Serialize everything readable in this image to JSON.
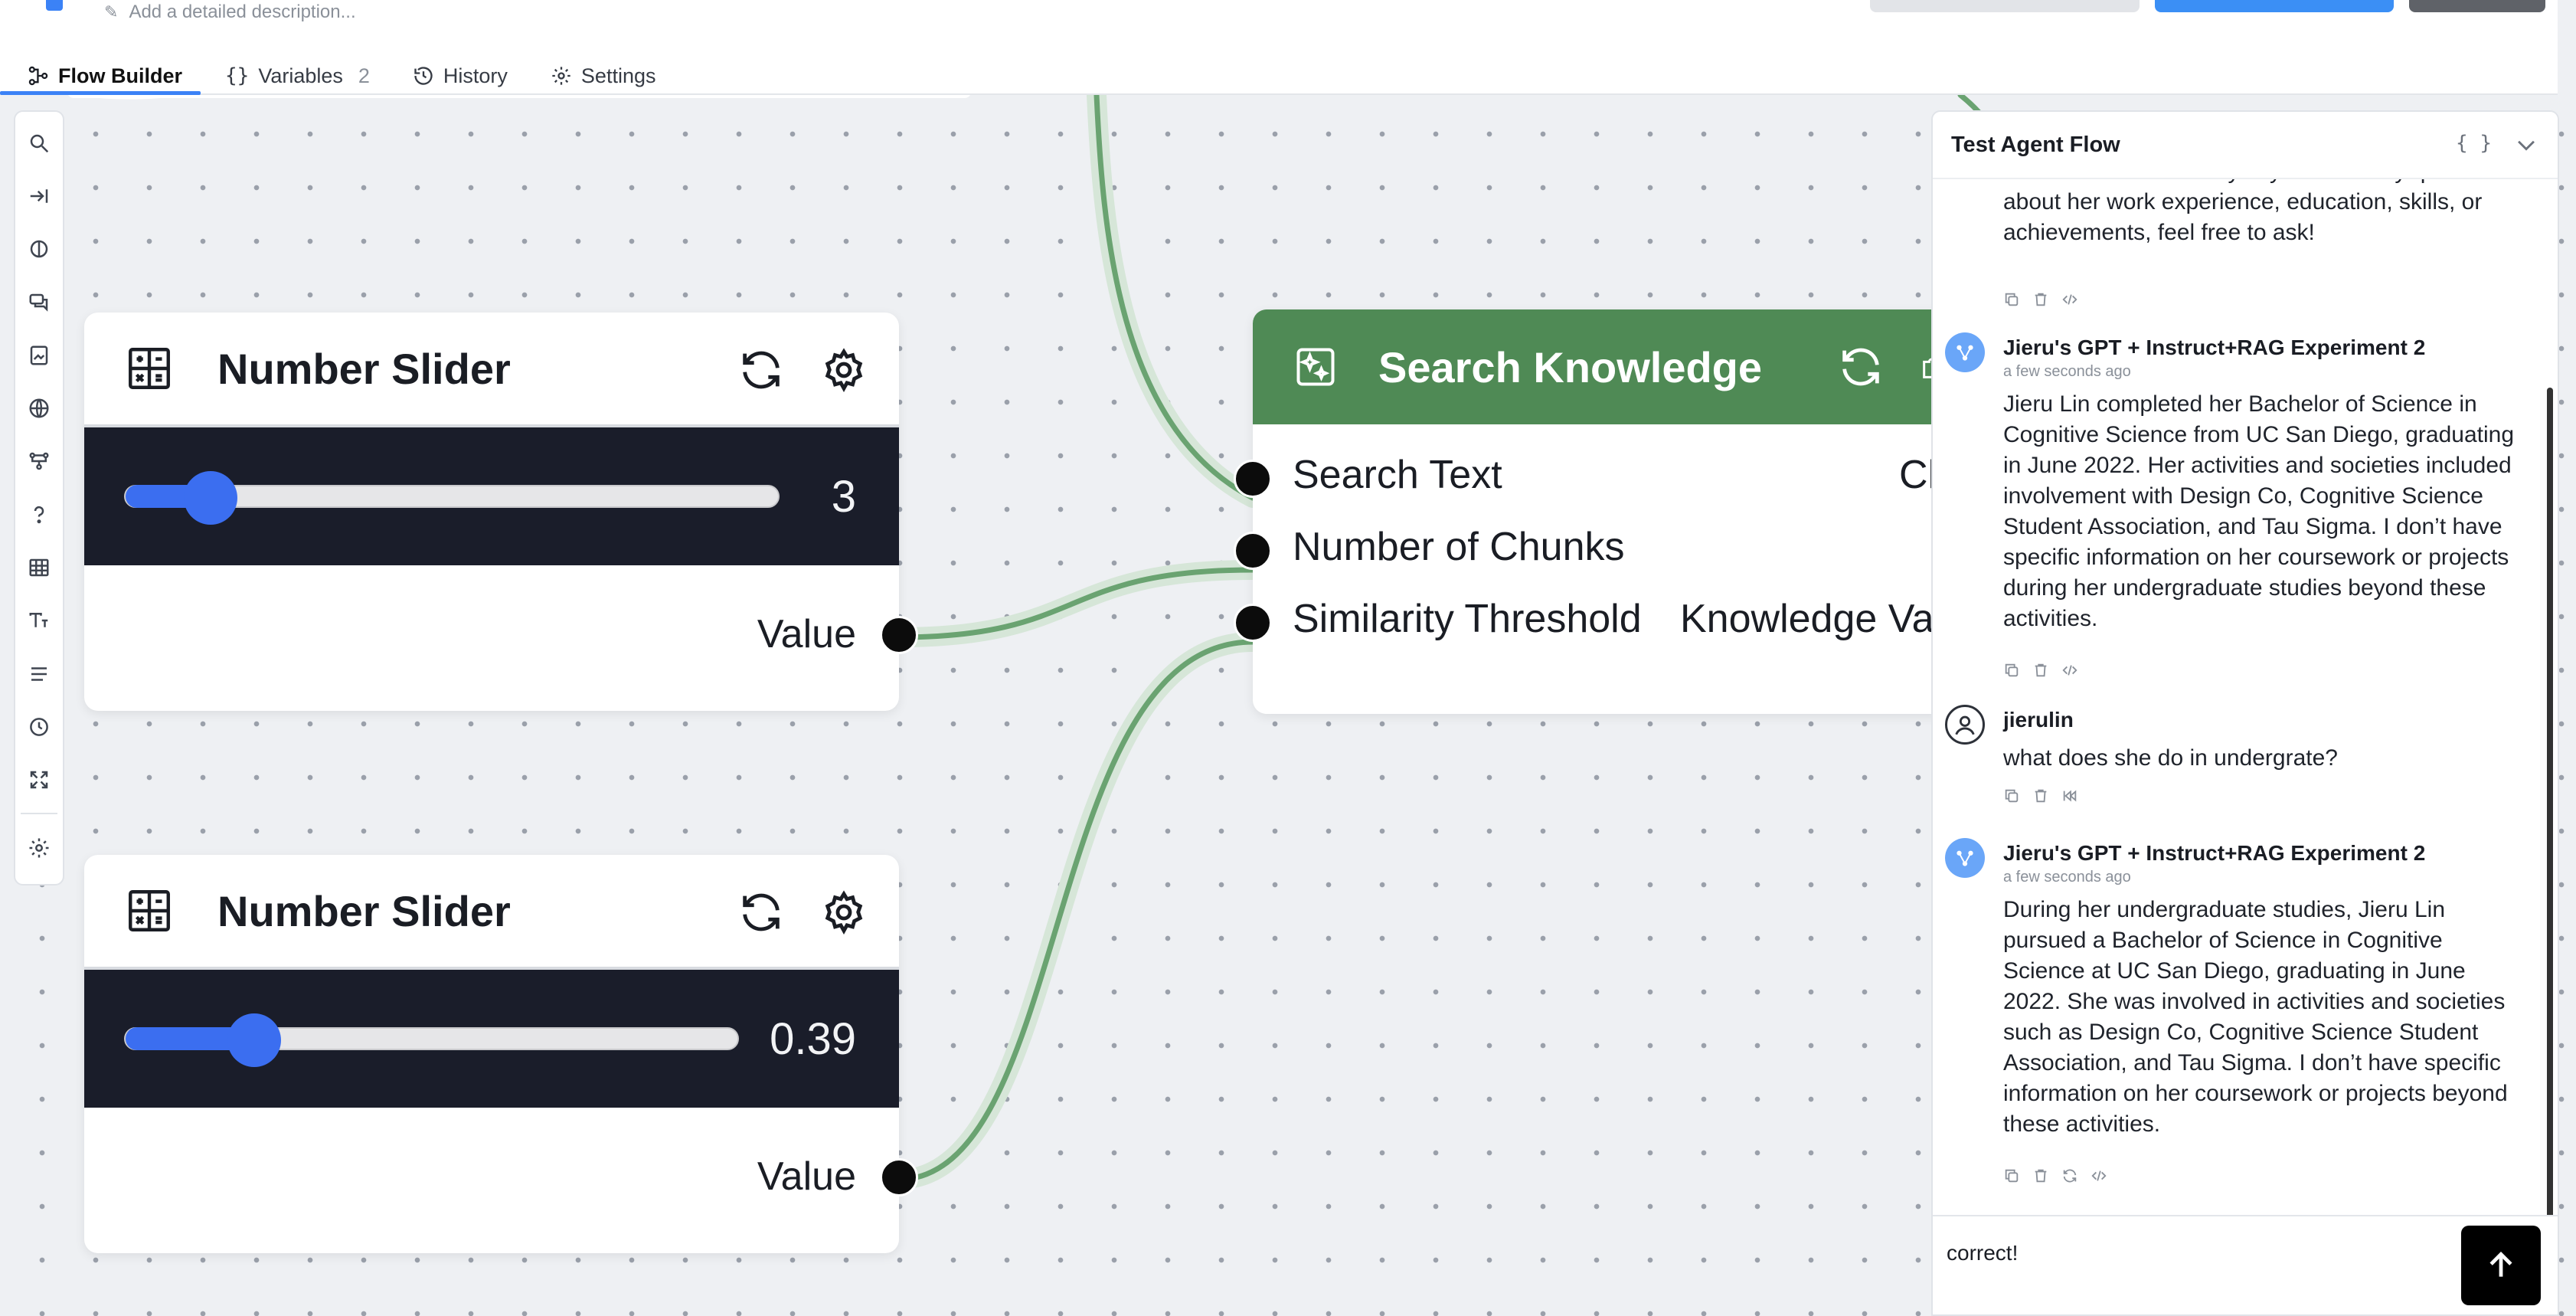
{
  "header": {
    "description_placeholder": "Add a detailed description..."
  },
  "tabs": [
    {
      "label": "Flow Builder",
      "active": true
    },
    {
      "label": "Variables",
      "count": "2"
    },
    {
      "label": "History"
    },
    {
      "label": "Settings"
    }
  ],
  "toolbar": {
    "icons": [
      "search-icon",
      "collapse-icon",
      "half-circle-icon",
      "chat-icon",
      "image-icon",
      "globe-icon",
      "flow-icon",
      "question-icon",
      "table-icon",
      "text-icon",
      "list-icon",
      "clock-icon",
      "expand-icon",
      "settings-icon"
    ]
  },
  "nodes": {
    "slider1": {
      "title": "Number Slider",
      "value_display": "3",
      "value_fraction": 0.13,
      "output_label": "Value"
    },
    "slider2": {
      "title": "Number Slider",
      "value_display": "0.39",
      "value_fraction": 0.21,
      "output_label": "Value"
    },
    "search_knowledge": {
      "title": "Search Knowledge",
      "inputs": [
        "Search Text",
        "Number of Chunks",
        "Similarity Threshold"
      ],
      "outputs": [
        "Ch",
        "Knowledge Va"
      ]
    }
  },
  "chat": {
    "title": "Test Agent Flow",
    "messages": [
      {
        "type": "bot-partial",
        "text": "clear and accurate way. If you have any questions about her work experience, education, skills, or achievements, feel free to ask!"
      },
      {
        "type": "bot",
        "author": "Jieru's GPT + Instruct+RAG Experiment 2",
        "time": "a few seconds ago",
        "text": "Jieru Lin completed her Bachelor of Science in Cognitive Science from UC San Diego, graduating in June 2022. Her activities and societies included involvement with Design Co, Cognitive Science Student Association, and Tau Sigma. I don’t have specific information on her coursework or projects during her undergraduate studies beyond these activities."
      },
      {
        "type": "user",
        "author": "jierulin",
        "text": "what does she do in undergrate?"
      },
      {
        "type": "bot",
        "author": "Jieru's GPT + Instruct+RAG Experiment 2",
        "time": "a few seconds ago",
        "text": "During her undergraduate studies, Jieru Lin pursued a Bachelor of Science in Cognitive Science at UC San Diego, graduating in June 2022. She was involved in activities and societies such as Design Co, Cognitive Science Student Association, and Tau Sigma. I don’t have specific information on her coursework or projects beyond these activities."
      }
    ],
    "input_value": "correct!"
  },
  "colors": {
    "accent": "#3b82f6",
    "node_green": "#4f8a55",
    "edge_green": "#6aa371",
    "slider_blue": "#3b6ef0",
    "slider_band": "#1a1d2a"
  }
}
